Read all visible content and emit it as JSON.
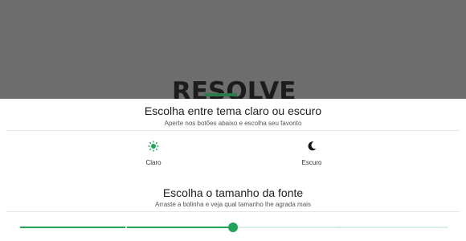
{
  "background": {
    "logo_text": "RESOLVE"
  },
  "theme_section": {
    "title": "Escolha entre tema claro ou escuro",
    "subtitle": "Aperte nos botões abaixo e escolha seu favorito",
    "options": [
      {
        "label": "Claro",
        "icon": "sun-icon"
      },
      {
        "label": "Escuro",
        "icon": "moon-icon"
      }
    ]
  },
  "font_section": {
    "title": "Escolha o tamanho da fonte",
    "subtitle": "Arraste a bolinha e veja qual tamanho lhe agrada mais",
    "slider": {
      "value_fraction": 0.5,
      "divisions": 4
    }
  },
  "colors": {
    "accent": "#21a35a",
    "track_inactive": "#d8f0e2",
    "overlay": "#6d6d6d",
    "logo_stripe": "#2a7a4b"
  }
}
